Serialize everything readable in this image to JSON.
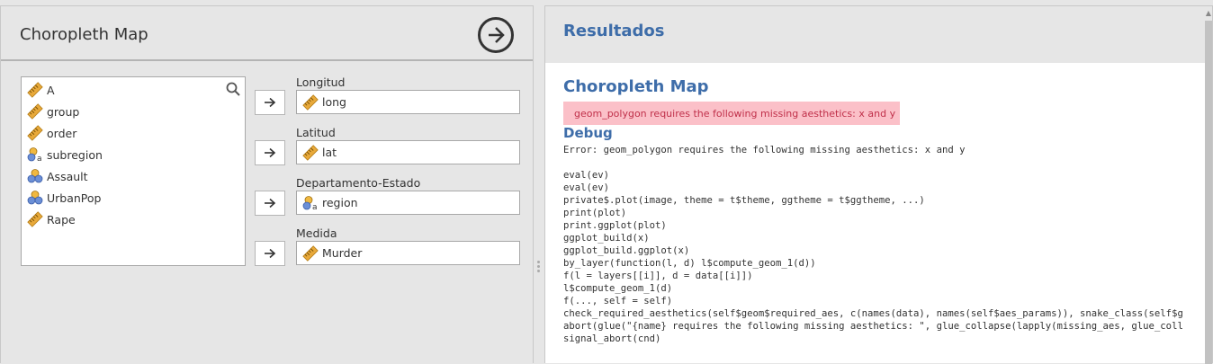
{
  "left_panel": {
    "title": "Choropleth Map",
    "variables": [
      {
        "name": "A",
        "type": "continuous"
      },
      {
        "name": "group",
        "type": "continuous"
      },
      {
        "name": "order",
        "type": "continuous"
      },
      {
        "name": "subregion",
        "type": "nominal-text"
      },
      {
        "name": "Assault",
        "type": "nominal"
      },
      {
        "name": "UrbanPop",
        "type": "nominal"
      },
      {
        "name": "Rape",
        "type": "continuous"
      }
    ],
    "targets": [
      {
        "label": "Longitud",
        "value": "long",
        "type": "continuous"
      },
      {
        "label": "Latitud",
        "value": "lat",
        "type": "continuous"
      },
      {
        "label": "Departamento-Estado",
        "value": "region",
        "type": "nominal-text"
      },
      {
        "label": "Medida",
        "value": "Murder",
        "type": "continuous"
      }
    ]
  },
  "right_panel": {
    "header": "Resultados",
    "result_title": "Choropleth Map",
    "error_message": "geom_polygon requires the following missing aesthetics: x and y",
    "debug_title": "Debug",
    "debug_lines": [
      "Error: geom_polygon requires the following missing aesthetics: x and y",
      "",
      "eval(ev)",
      "eval(ev)",
      "private$.plot(image, theme = t$theme, ggtheme = t$ggtheme, ...)",
      "print(plot)",
      "print.ggplot(plot)",
      "ggplot_build(x)",
      "ggplot_build.ggplot(x)",
      "by_layer(function(l, d) l$compute_geom_1(d))",
      "f(l = layers[[i]], d = data[[i]])",
      "l$compute_geom_1(d)",
      "f(..., self = self)",
      "check_required_aesthetics(self$geom$required_aes, c(names(data), names(self$aes_params)), snake_class(self$g",
      "abort(glue(\"{name} requires the following missing aesthetics: \", glue_collapse(lapply(missing_aes, glue_coll",
      "signal_abort(cnd)"
    ]
  },
  "colors": {
    "accent": "#3e6da9",
    "error_bg": "#fbc0c8",
    "error_text": "#c0304a",
    "ruler": "#e8a93a",
    "nominal": "#6b8fd6"
  }
}
